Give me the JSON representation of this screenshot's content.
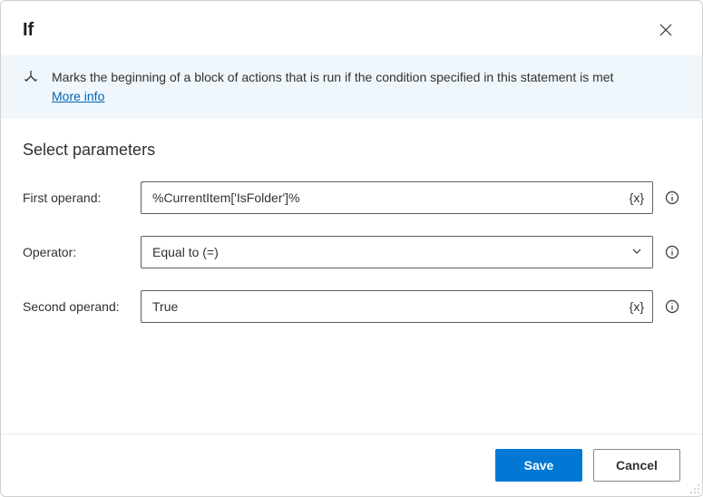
{
  "header": {
    "title": "If"
  },
  "banner": {
    "description": "Marks the beginning of a block of actions that is run if the condition specified in this statement is met",
    "more_info_label": "More info"
  },
  "section": {
    "title": "Select parameters"
  },
  "fields": {
    "first_operand": {
      "label": "First operand:",
      "value": "%CurrentItem['IsFolder']%",
      "var_token": "{x}"
    },
    "operator": {
      "label": "Operator:",
      "value": "Equal to (=)"
    },
    "second_operand": {
      "label": "Second operand:",
      "value": "True",
      "var_token": "{x}"
    }
  },
  "footer": {
    "save_label": "Save",
    "cancel_label": "Cancel"
  }
}
